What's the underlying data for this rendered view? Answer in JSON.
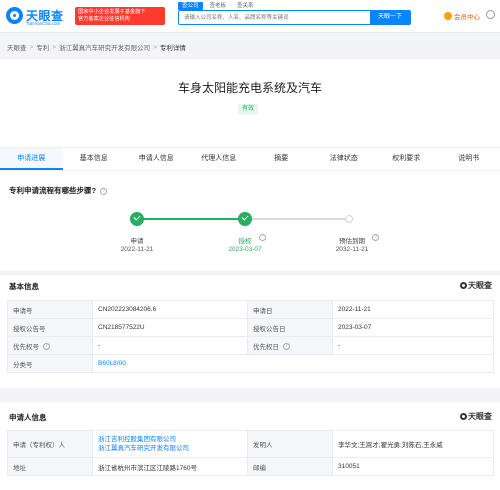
{
  "header": {
    "logo_cn": "天眼查",
    "logo_en": "TianYanCha.com",
    "promo_line1": "国家中小企业发展子基金旗下",
    "promo_line2": "官方备案企业征信机构",
    "search_tabs": [
      "查公司",
      "查老板",
      "查关系"
    ],
    "search_placeholder": "请输入公司名称、人名、品牌名称等关键词",
    "search_button": "天眼一下",
    "vip_label": "会员中心",
    "colors": {
      "brand": "#0a84ff",
      "promo": "#ff3b30",
      "vip": "#e8590c"
    }
  },
  "breadcrumb": [
    "天眼查",
    "专利",
    "浙江翼真汽车研究开发有限公司",
    "专利详情"
  ],
  "patent": {
    "title": "车身太阳能充电系统及汽车",
    "status": "有效"
  },
  "tabs": [
    "申请进展",
    "基本信息",
    "申请人信息",
    "代理人信息",
    "摘要",
    "法律状态",
    "权利要求",
    "说明书"
  ],
  "progress": {
    "heading": "专利申请流程有哪些步骤?",
    "steps": [
      {
        "label": "申请",
        "date": "2022-11-21",
        "state": "done"
      },
      {
        "label": "授权",
        "date": "2023-03-07",
        "state": "done"
      },
      {
        "label": "预估到期",
        "date": "2032-11-21",
        "state": "pending"
      }
    ],
    "colors": {
      "done": "#27ae60",
      "pending": "#d9dde3"
    }
  },
  "watermark": "天眼查",
  "basic_info": {
    "heading": "基本信息",
    "rows": [
      {
        "l1": "申请号",
        "v1": "CN202223084206.6",
        "l2": "申请日",
        "v2": "2022-11-21"
      },
      {
        "l1": "授权公告号",
        "v1": "CN218577522U",
        "l2": "授权公告日",
        "v2": "2023-03-07"
      },
      {
        "l1": "优先权号",
        "v1": "-",
        "l2": "优先权日",
        "v2": "-"
      }
    ],
    "class_label": "分类号",
    "class_value": "B60L8/00"
  },
  "applicant_info": {
    "heading": "申请人信息",
    "applicant_label": "申请（专利权）人",
    "applicants": [
      "浙江吉利控股集团有限公司",
      "浙江翼真汽车研究开发有限公司"
    ],
    "inventor_label": "发明人",
    "inventors": "李华文;王嵩才;翟光勇;刘陈石;王永威",
    "address_label": "地址",
    "address": "浙江省杭州市滨江区江陵路1760号",
    "zip_label": "邮编",
    "zip": "310051"
  }
}
